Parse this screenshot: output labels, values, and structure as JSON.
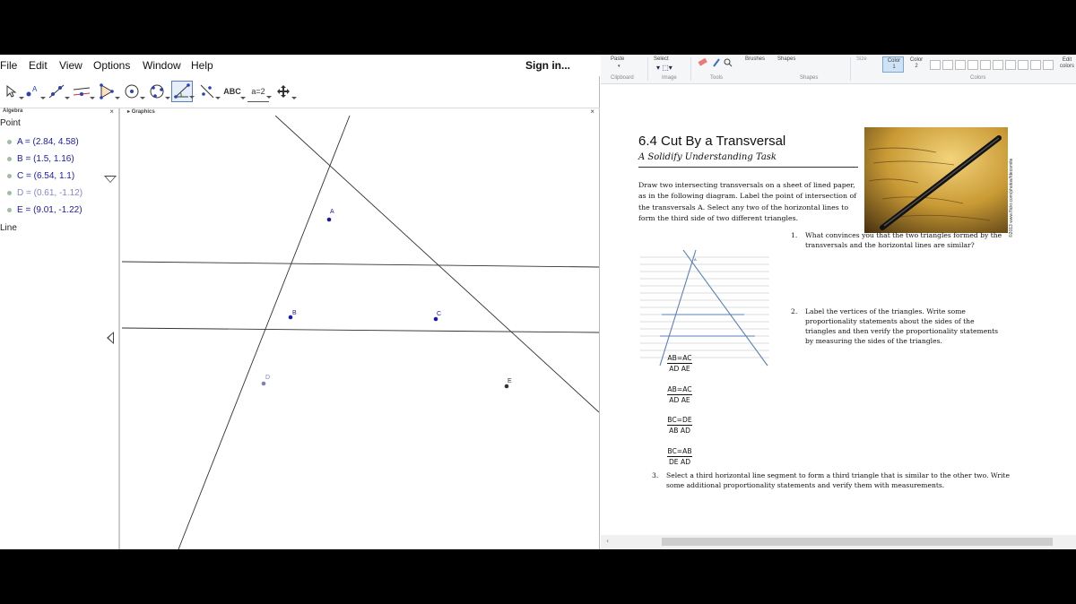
{
  "geogebra": {
    "menus": [
      "File",
      "Edit",
      "View",
      "Options",
      "Window",
      "Help"
    ],
    "sign_in": "Sign in...",
    "toolbar": {
      "tools": [
        "move-tool",
        "point-tool",
        "line-tool",
        "perpendicular-tool",
        "polygon-tool",
        "circle-tool",
        "circle-three-points-tool",
        "angle-tool",
        "reflect-tool",
        "ABC",
        "a=2",
        "move-graphics-tool"
      ],
      "active_index": 7
    },
    "algebra": {
      "title": "Algebra",
      "close": "×",
      "category_point": "Point",
      "category_line": "Line",
      "points": [
        {
          "label": "A = (2.84, 4.58)",
          "dim": false
        },
        {
          "label": "B = (1.5, 1.16)",
          "dim": false
        },
        {
          "label": "C = (6.54, 1.1)",
          "dim": false
        },
        {
          "label": "D = (0.61, -1.12)",
          "dim": true
        },
        {
          "label": "E = (9.01, -1.22)",
          "dim": false
        }
      ]
    },
    "graphics": {
      "title": "Graphics",
      "close": "×",
      "point_labels": [
        "A",
        "B",
        "C",
        "D",
        "E"
      ]
    }
  },
  "paint": {
    "ribbon": {
      "paste": "Paste",
      "select": "Select",
      "brushes": "Brushes",
      "shapes": "Shapes",
      "size": "Size",
      "color1": "Color\n1",
      "color2": "Color\n2",
      "edit_colors": "Edit\ncolors",
      "groups": [
        "Clipboard",
        "Image",
        "Tools",
        "Shapes",
        "Colors"
      ]
    },
    "document": {
      "title": "6.4 Cut By a Transversal",
      "subtitle": "A Solidify Understanding Task",
      "intro": "Draw two intersecting transversals on a sheet of lined paper, as in the following diagram.  Label the point of intersection of the transversals A.  Select any two of the horizontal lines to form the third side of two different triangles.",
      "photo_credit": "©2013 www.flickr.com/photos/fdecomite",
      "diagram_label": "A",
      "questions": [
        {
          "num": "1.",
          "text": "What convinces you that the two triangles formed by the transversals and the horizontal lines are similar?"
        },
        {
          "num": "2.",
          "text": "Label the vertices of the triangles.  Write some proportionality statements about the sides of the triangles and then verify the proportionality statements by measuring the sides of the triangles."
        },
        {
          "num": "3.",
          "text": "Select a third horizontal line segment to form a third triangle that is similar to the other two. Write some additional proportionality statements and verify them with measurements."
        }
      ],
      "fractions": [
        {
          "num": "AB=AC",
          "den": "AD  AE"
        },
        {
          "num": "AB=AC",
          "den": "AD  AE"
        },
        {
          "num": "BC=DE",
          "den": "AB  AD"
        },
        {
          "num": "BC=AB",
          "den": "DE  AD"
        }
      ]
    }
  }
}
